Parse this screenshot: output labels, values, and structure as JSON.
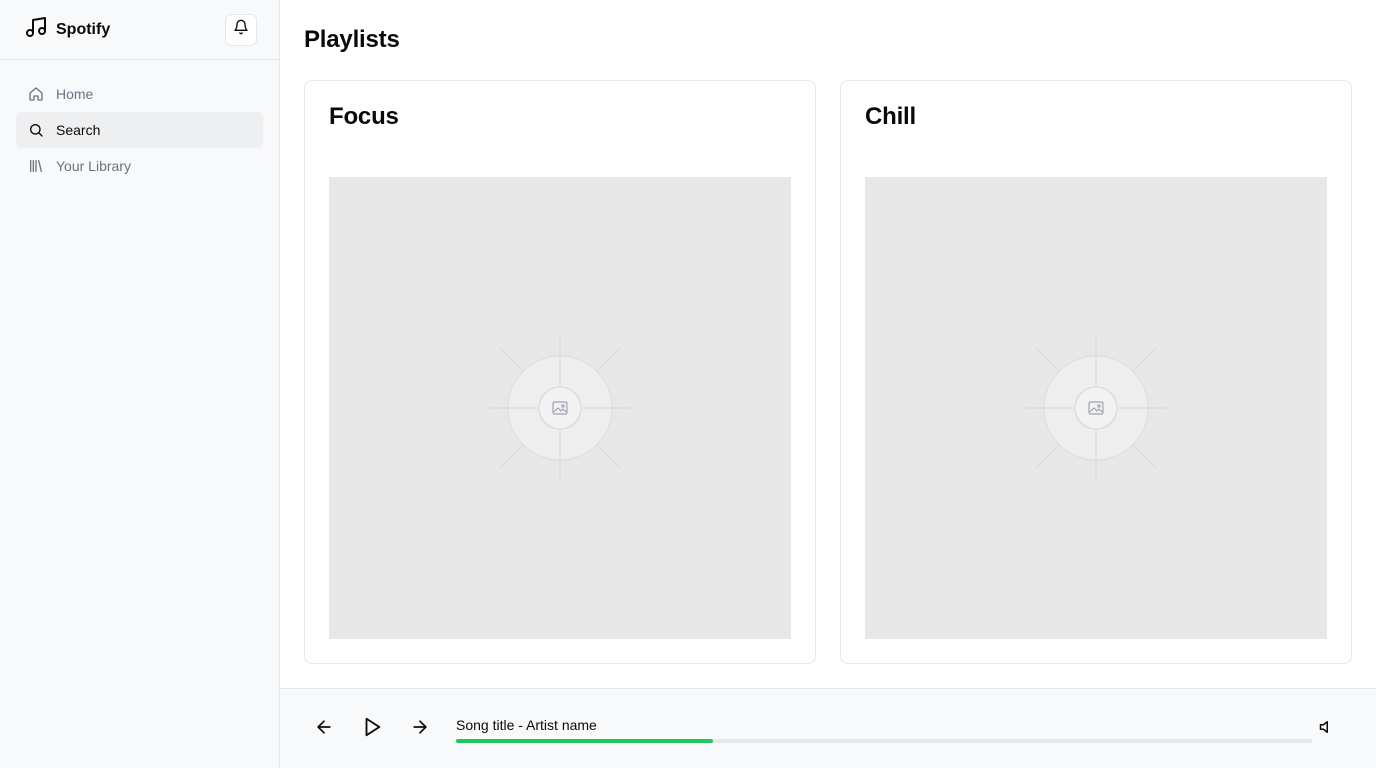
{
  "sidebar": {
    "brand": {
      "name": "Spotify",
      "icon": "music-note-icon"
    },
    "notifications_icon": "bell-icon",
    "items": [
      {
        "label": "Home",
        "icon": "home-icon",
        "active": false
      },
      {
        "label": "Search",
        "icon": "search-icon",
        "active": true
      },
      {
        "label": "Your Library",
        "icon": "library-icon",
        "active": false
      }
    ]
  },
  "main": {
    "title": "Playlists",
    "playlists": [
      {
        "title": "Focus",
        "cover_icon": "image-placeholder-icon"
      },
      {
        "title": "Chill",
        "cover_icon": "image-placeholder-icon"
      }
    ]
  },
  "player": {
    "now_playing": "Song title - Artist name",
    "progress_fraction": 0.3,
    "controls": [
      "previous-icon",
      "play-icon",
      "next-icon",
      "volume-icon"
    ]
  },
  "colors": {
    "accent": "#22c55e",
    "sidebar_bg": "#f8f9fa",
    "active_item_bg": "#eeeff1",
    "cover_bg": "#e8e8e8",
    "border": "#e5e7eb"
  }
}
